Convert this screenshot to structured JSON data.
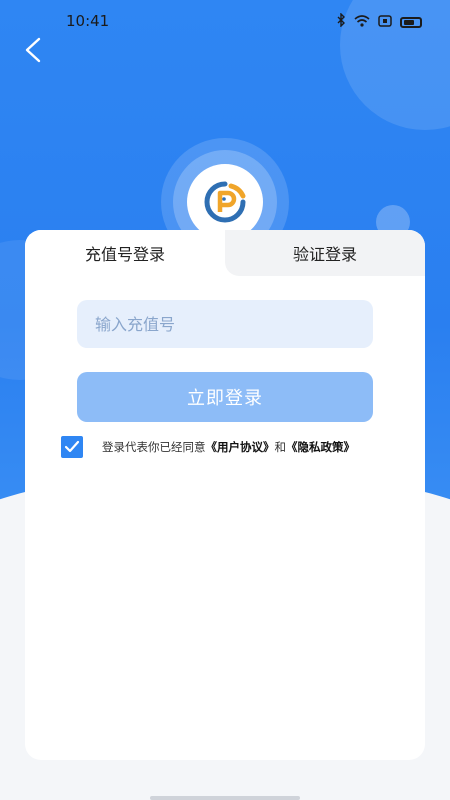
{
  "status_bar": {
    "time": "10:41"
  },
  "tabs": [
    {
      "label": "充值号登录",
      "active": true
    },
    {
      "label": "验证登录",
      "active": false
    }
  ],
  "form": {
    "recharge_input": {
      "value": "",
      "placeholder": "输入充值号"
    },
    "login_button": "立即登录"
  },
  "agreement": {
    "checked": true,
    "prefix": "登录代表你已经同意",
    "user_agreement": "《用户协议》",
    "conjunction": "和",
    "privacy_policy": "《隐私政策》"
  },
  "colors": {
    "primary": "#2f86f3",
    "button_disabled": "#8dbcf7",
    "input_bg": "#e6effc",
    "logo_blue": "#2f6fb3",
    "logo_orange": "#f0a52a"
  },
  "icons": {
    "back": "chevron-left-icon",
    "logo": "app-logo-icon",
    "check": "checkmark-icon"
  }
}
